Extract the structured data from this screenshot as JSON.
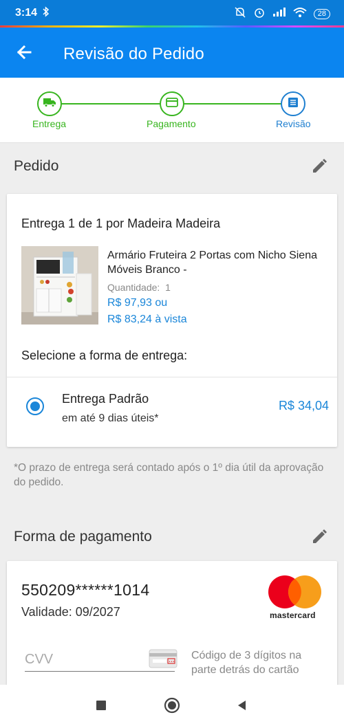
{
  "status_bar": {
    "time": "3:14",
    "battery": "28"
  },
  "app_bar": {
    "title": "Revisão do Pedido"
  },
  "stepper": {
    "steps": [
      {
        "label": "Entrega",
        "icon": "truck-icon"
      },
      {
        "label": "Pagamento",
        "icon": "card-icon"
      },
      {
        "label": "Revisão",
        "icon": "list-icon"
      }
    ],
    "colors": {
      "done": "#38b51f",
      "active": "#1e7fd0"
    }
  },
  "order": {
    "section_title": "Pedido",
    "delivery_title": "Entrega 1 de 1 por Madeira Madeira",
    "product": {
      "name": "Armário Fruteira 2 Portas com Nicho Siena Móveis Branco -",
      "quantity_label": "Quantidade:",
      "quantity": "1",
      "price_installment": "R$ 97,93 ou",
      "price_cash": "R$ 83,24 à vista"
    },
    "select_shipping_label": "Selecione a forma de entrega:",
    "shipping_option": {
      "name": "Entrega Padrão",
      "eta": "em até 9 dias úteis*",
      "price": "R$ 34,04",
      "selected": true
    },
    "note": "*O prazo de entrega será contado após o 1º dia útil da aprovação do pedido."
  },
  "payment": {
    "section_title": "Forma de pagamento",
    "card_number": "550209******1014",
    "validity": "Validade: 09/2027",
    "brand": "mastercard",
    "cvv_placeholder": "CVV",
    "cvv_help": "Código de 3 dígitos na parte detrás do cartão"
  },
  "theme": {
    "primary": "#0b85f0",
    "accent_blue": "#1a86d9"
  }
}
